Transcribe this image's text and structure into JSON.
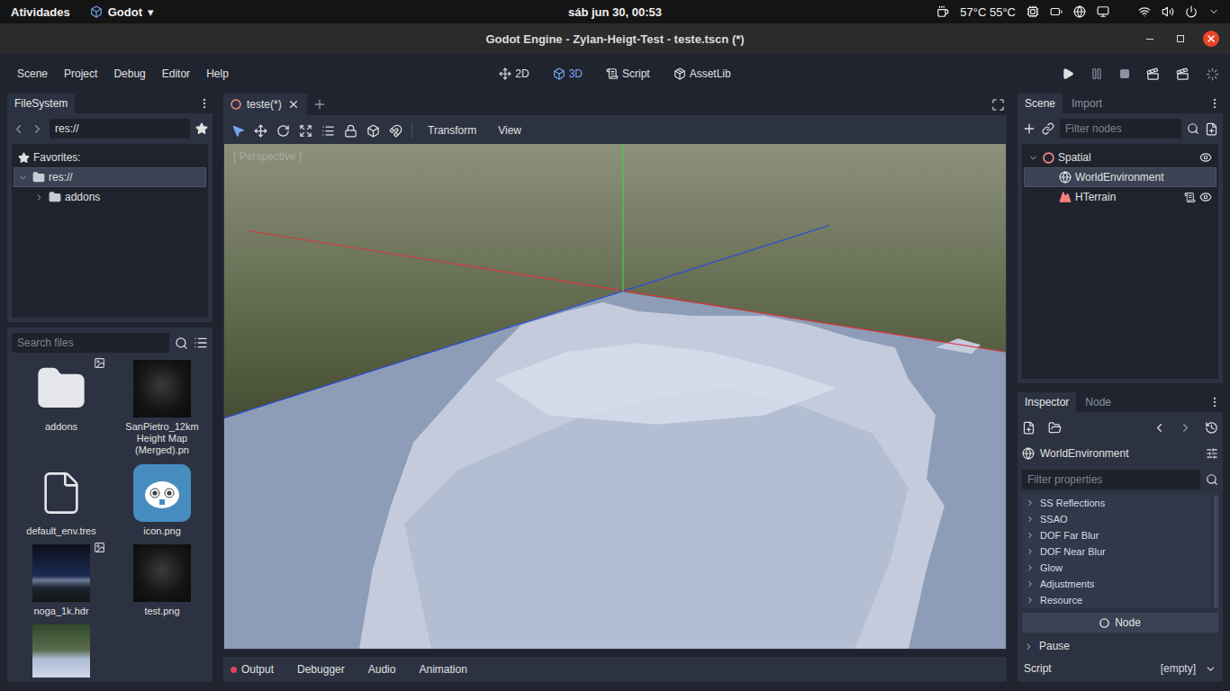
{
  "topbar": {
    "activities": "Atividades",
    "app": "Godot",
    "app_arrow": "▾",
    "clock": "sáb jun 30, 00:53",
    "temps": "57°C 55°C"
  },
  "window": {
    "title": "Godot Engine - Zylan-Heigt-Test - teste.tscn (*)"
  },
  "menu": [
    "Scene",
    "Project",
    "Debug",
    "Editor",
    "Help"
  ],
  "workspaces": [
    {
      "label": "2D",
      "selected": false
    },
    {
      "label": "3D",
      "selected": true
    },
    {
      "label": "Script",
      "selected": false
    },
    {
      "label": "AssetLib",
      "selected": false
    }
  ],
  "filesystem": {
    "tab": "FileSystem",
    "path": "res://",
    "favorites": "Favorites:",
    "tree": {
      "label": "res://",
      "selected": true,
      "expanded": true,
      "children": [
        {
          "label": "addons",
          "selected": false,
          "expanded": false
        }
      ]
    },
    "search_placeholder": "Search files",
    "files": [
      {
        "name": "addons",
        "kind": "folder"
      },
      {
        "name": "SanPietro_12km Height Map (Merged).pn",
        "kind": "image"
      },
      {
        "name": "default_env.tres",
        "kind": "resource"
      },
      {
        "name": "icon.png",
        "kind": "godot"
      },
      {
        "name": "noga_1k.hdr",
        "kind": "hdr"
      },
      {
        "name": "test.png",
        "kind": "image"
      },
      {
        "kind": "scene"
      }
    ]
  },
  "editor_tabs": [
    {
      "label": "teste(*)",
      "selected": true
    }
  ],
  "viewport_menus": [
    "Transform",
    "View"
  ],
  "viewport": {
    "label": "[ Perspective ]"
  },
  "bottom_tabs": [
    {
      "label": "Output",
      "alert": true
    },
    {
      "label": "Debugger",
      "alert": false
    },
    {
      "label": "Audio",
      "alert": false
    },
    {
      "label": "Animation",
      "alert": false
    }
  ],
  "scene": {
    "tabs": [
      {
        "label": "Scene",
        "selected": true
      },
      {
        "label": "Import",
        "selected": false
      }
    ],
    "filter_placeholder": "Filter nodes",
    "nodes": [
      {
        "name": "Spatial",
        "kind": "spatial",
        "selected": false,
        "expanded": true,
        "script": false,
        "visible": true,
        "children": [
          {
            "name": "WorldEnvironment",
            "kind": "environment",
            "selected": true,
            "script": false,
            "visible": false
          },
          {
            "name": "HTerrain",
            "kind": "terrain",
            "selected": false,
            "script": true,
            "visible": true
          }
        ]
      }
    ]
  },
  "inspector": {
    "tabs": [
      {
        "label": "Inspector",
        "selected": true
      },
      {
        "label": "Node",
        "selected": false
      }
    ],
    "object": "WorldEnvironment",
    "filter_placeholder": "Filter properties",
    "sections": [
      "SS Reflections",
      "SSAO",
      "DOF Far Blur",
      "DOF Near Blur",
      "Glow",
      "Adjustments",
      "Resource"
    ],
    "category": "Node",
    "groups": [
      "Pause"
    ],
    "properties": [
      {
        "name": "Script",
        "value": "[empty]"
      }
    ]
  }
}
